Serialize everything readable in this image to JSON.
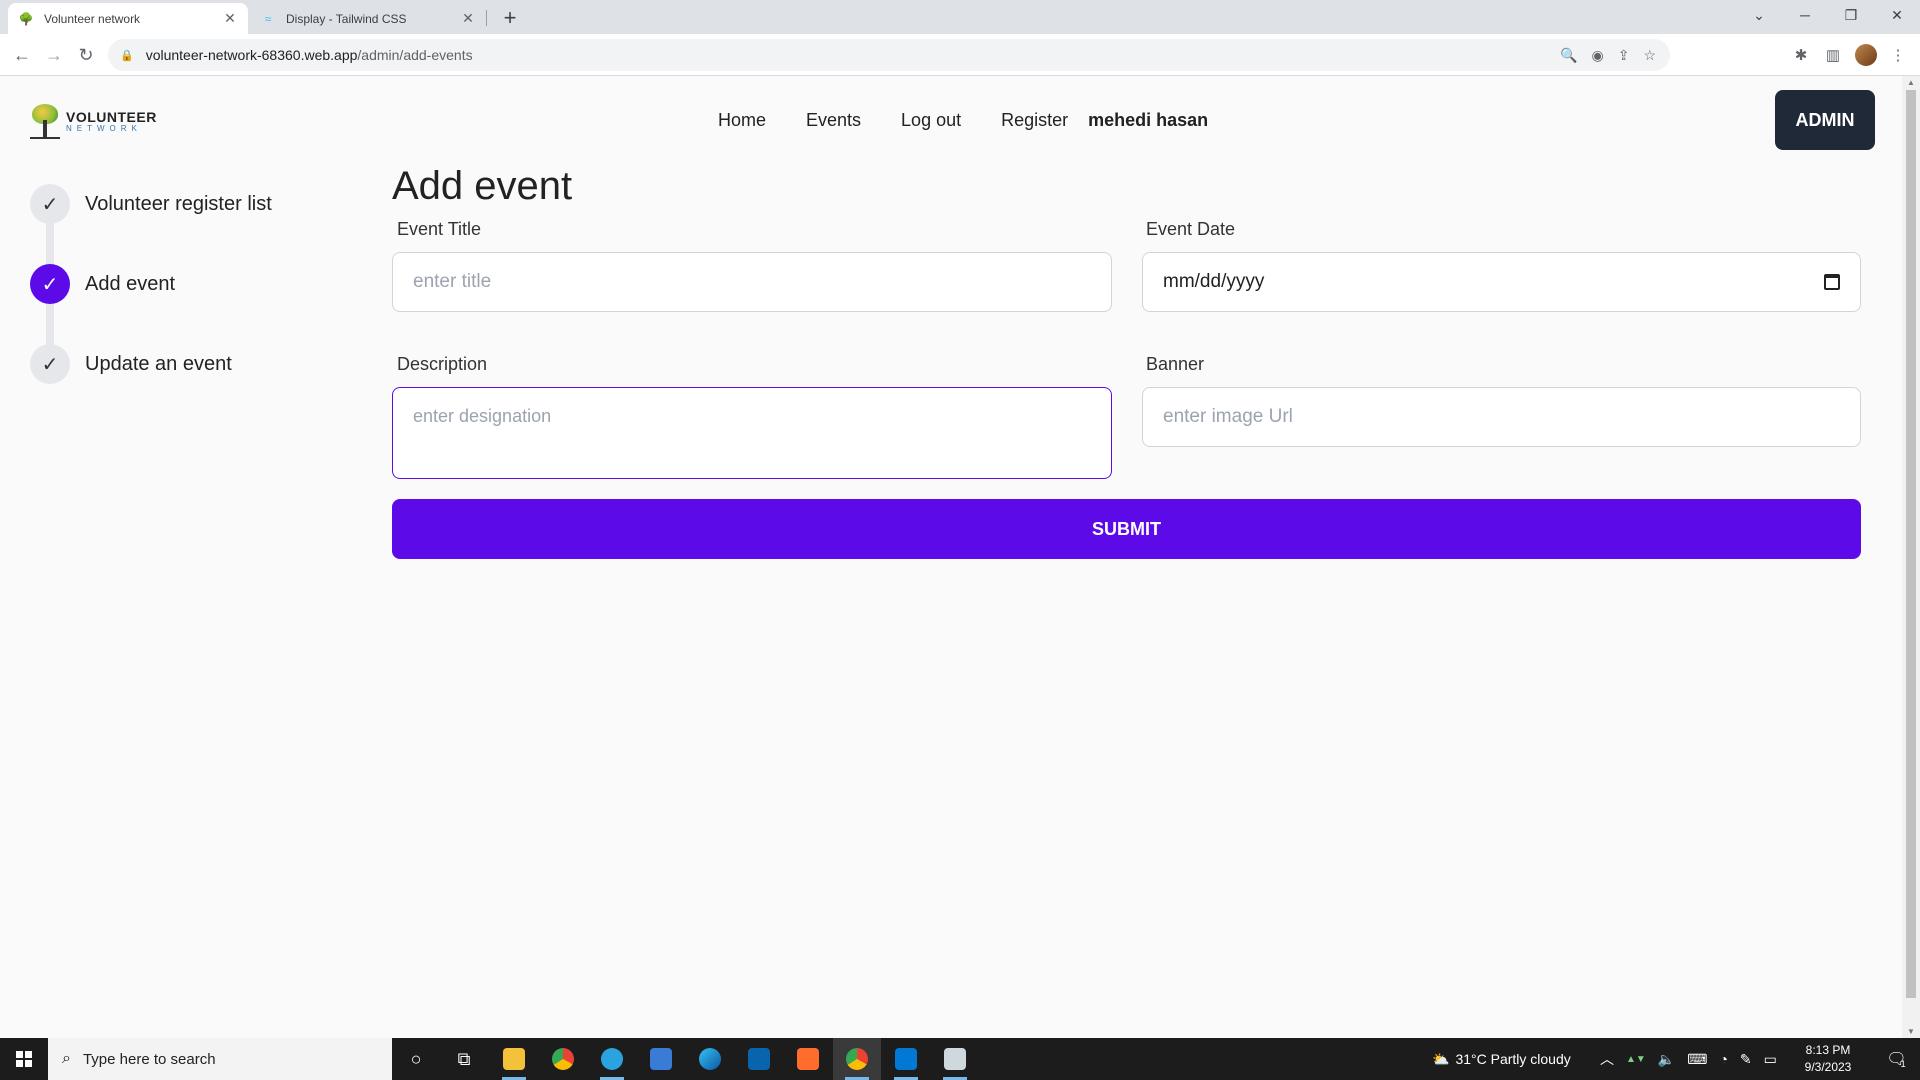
{
  "browser": {
    "tabs": [
      {
        "title": "Volunteer network",
        "active": true
      },
      {
        "title": "Display - Tailwind CSS",
        "active": false
      }
    ],
    "url_host": "volunteer-network-68360.web.app",
    "url_path": "/admin/add-events"
  },
  "site": {
    "logo_line1": "VOLUNTEER",
    "logo_line2": "NETWORK",
    "nav": {
      "home": "Home",
      "events": "Events",
      "logout": "Log out",
      "register": "Register",
      "user": "mehedi hasan"
    },
    "admin_button": "ADMIN"
  },
  "sidebar": {
    "steps": [
      {
        "label": "Volunteer register list",
        "icon": "check-icon",
        "active": false
      },
      {
        "label": "Add event",
        "icon": "check-icon",
        "active": true
      },
      {
        "label": "Update an event",
        "icon": "check-icon",
        "active": false
      }
    ],
    "check_glyph": "✓"
  },
  "form": {
    "heading": "Add event",
    "title_label": "Event Title",
    "title_placeholder": "enter title",
    "date_label": "Event Date",
    "date_value": "mm/dd/yyyy",
    "description_label": "Description",
    "description_placeholder": "enter designation",
    "banner_label": "Banner",
    "banner_placeholder": "enter image Url",
    "submit_label": "SUBMIT"
  },
  "taskbar": {
    "search_placeholder": "Type here to search",
    "weather": "31°C  Partly cloudy",
    "time": "8:13 PM",
    "date": "9/3/2023",
    "notification_count": "1"
  },
  "colors": {
    "accent": "#5c0be8",
    "admin_bg": "#1f2937",
    "logo_blue": "#2e75b6"
  }
}
